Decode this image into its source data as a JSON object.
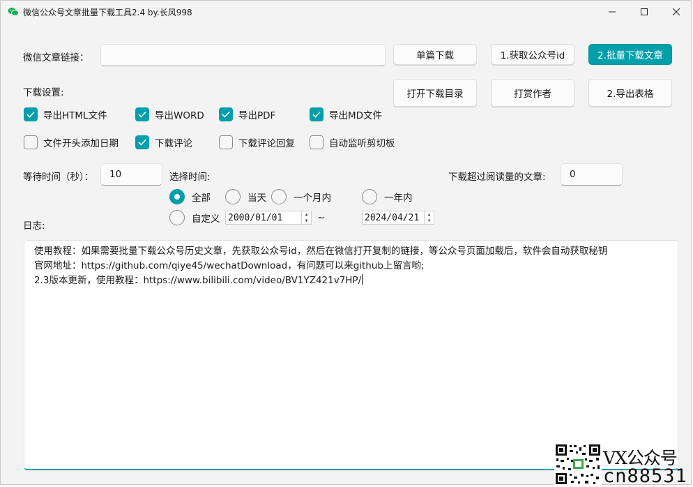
{
  "window": {
    "title": "微信公众号文章批量下载工具2.4 by.长风998"
  },
  "link": {
    "label": "微信文章链接：",
    "value": ""
  },
  "buttons": {
    "single_download": "单篇下载",
    "get_id": "1.获取公众号id",
    "batch_download": "2.批量下载文章",
    "open_dir": "打开下载目录",
    "tip_author": "打赏作者",
    "export_table": "2.导出表格"
  },
  "settings": {
    "label": "下载设置:",
    "checkboxes": [
      {
        "label": "导出HTML文件",
        "checked": true
      },
      {
        "label": "导出WORD",
        "checked": true
      },
      {
        "label": "导出PDF",
        "checked": true
      },
      {
        "label": "导出MD文件",
        "checked": true
      },
      {
        "label": "文件开头添加日期",
        "checked": false
      },
      {
        "label": "下载评论",
        "checked": true
      },
      {
        "label": "下载评论回复",
        "checked": false
      },
      {
        "label": "自动监听剪切板",
        "checked": false
      }
    ]
  },
  "wait": {
    "label": "等待时间（秒）：",
    "value": "10"
  },
  "time": {
    "label": "选择时间:",
    "options": [
      "全部",
      "当天",
      "一个月内",
      "一年内",
      "自定义"
    ],
    "selected": "全部",
    "start_date": "2000/01/01",
    "separator": "~",
    "end_date": "2024/04/21"
  },
  "read_filter": {
    "label": "下载超过阅读量的文章:",
    "value": "0"
  },
  "log": {
    "label": "日志:",
    "lines": [
      "使用教程：如果需要批量下载公众号历史文章，先获取公众号id，然后在微信打开复制的链接，等公众号页面加载后，软件会自动获取秘钥",
      "官网地址：https://github.com/qiye45/wechatDownload，有问题可以来github上留言哟;",
      "2.3版本更新，使用教程：https://www.bilibili.com/video/BV1YZ421v7HP/"
    ]
  },
  "watermark": {
    "line1": "VX公众号",
    "line2": "cn88531"
  },
  "colors": {
    "accent": "#009faa"
  }
}
